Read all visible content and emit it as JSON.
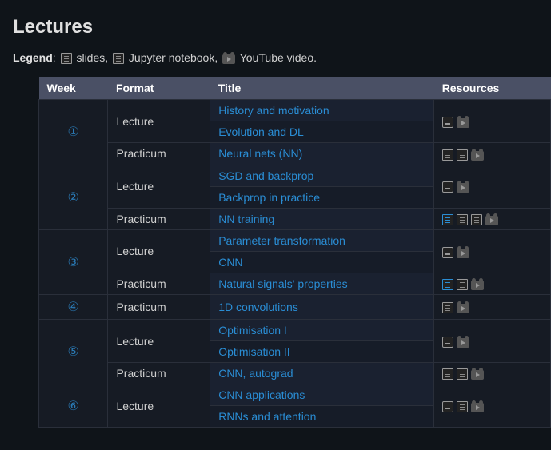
{
  "heading": "Lectures",
  "legend": {
    "prefix": "Legend",
    "items": [
      {
        "icon": "notebook",
        "text": "slides,"
      },
      {
        "icon": "notebook",
        "text": "Jupyter notebook,"
      },
      {
        "icon": "video",
        "text": "YouTube video."
      }
    ]
  },
  "columns": {
    "week": "Week",
    "format": "Format",
    "title": "Title",
    "resources": "Resources"
  },
  "weeks": [
    {
      "symbol": "①",
      "sessions": [
        {
          "format": "Lecture",
          "titles": [
            "History and motivation",
            "Evolution and DL"
          ],
          "resources": [
            [
              "slides"
            ],
            [
              "video"
            ]
          ]
        },
        {
          "format": "Practicum",
          "titles": [
            "Neural nets (NN)"
          ],
          "resources": [
            [
              "notebook"
            ],
            [
              "notebook"
            ],
            [
              "video"
            ]
          ]
        }
      ]
    },
    {
      "symbol": "②",
      "sessions": [
        {
          "format": "Lecture",
          "titles": [
            "SGD and backprop",
            "Backprop in practice"
          ],
          "resources": [
            [
              "slides"
            ],
            [
              "video"
            ]
          ]
        },
        {
          "format": "Practicum",
          "titles": [
            "NN training"
          ],
          "resources": [
            [
              "notebook",
              "hi"
            ],
            [
              "notebook"
            ],
            [
              "notebook"
            ],
            [
              "video"
            ]
          ]
        }
      ]
    },
    {
      "symbol": "③",
      "sessions": [
        {
          "format": "Lecture",
          "titles": [
            "Parameter transformation",
            "CNN"
          ],
          "resources": [
            [
              "slides"
            ],
            [
              "video"
            ]
          ]
        },
        {
          "format": "Practicum",
          "titles": [
            "Natural signals' properties"
          ],
          "resources": [
            [
              "notebook",
              "hi"
            ],
            [
              "notebook"
            ],
            [
              "video"
            ]
          ]
        }
      ]
    },
    {
      "symbol": "④",
      "sessions": [
        {
          "format": "Practicum",
          "titles": [
            "1D convolutions"
          ],
          "resources": [
            [
              "notebook"
            ],
            [
              "video"
            ]
          ]
        }
      ]
    },
    {
      "symbol": "⑤",
      "sessions": [
        {
          "format": "Lecture",
          "titles": [
            "Optimisation I",
            "Optimisation II"
          ],
          "resources": [
            [
              "slides"
            ],
            [
              "video"
            ]
          ]
        },
        {
          "format": "Practicum",
          "titles": [
            "CNN, autograd"
          ],
          "resources": [
            [
              "notebook"
            ],
            [
              "notebook"
            ],
            [
              "video"
            ]
          ]
        }
      ]
    },
    {
      "symbol": "⑥",
      "sessions": [
        {
          "format": "Lecture",
          "titles": [
            "CNN applications",
            "RNNs and attention"
          ],
          "resources": [
            [
              "slides"
            ],
            [
              "notebook"
            ],
            [
              "video"
            ]
          ]
        }
      ]
    }
  ]
}
